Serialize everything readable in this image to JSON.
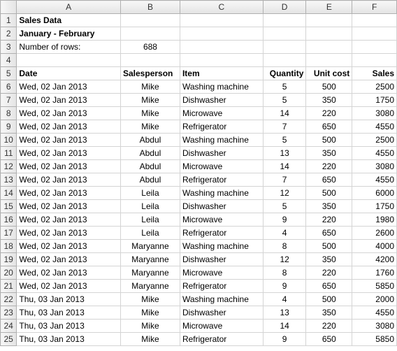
{
  "columns": [
    "A",
    "B",
    "C",
    "D",
    "E",
    "F"
  ],
  "row_numbers": [
    1,
    2,
    3,
    4,
    5,
    6,
    7,
    8,
    9,
    10,
    11,
    12,
    13,
    14,
    15,
    16,
    17,
    18,
    19,
    20,
    21,
    22,
    23,
    24,
    25
  ],
  "header": {
    "title": "Sales Data",
    "subtitle": "January - February",
    "num_rows_label": "Number of rows:",
    "num_rows_value": "688"
  },
  "table_headers": {
    "date": "Date",
    "salesperson": "Salesperson",
    "item": "Item",
    "quantity": "Quantity",
    "unit_cost": "Unit cost",
    "sales": "Sales"
  },
  "rows": [
    {
      "date": "Wed, 02 Jan 2013",
      "sp": "Mike",
      "item": "Washing machine",
      "qty": "5",
      "uc": "500",
      "sales": "2500"
    },
    {
      "date": "Wed, 02 Jan 2013",
      "sp": "Mike",
      "item": "Dishwasher",
      "qty": "5",
      "uc": "350",
      "sales": "1750"
    },
    {
      "date": "Wed, 02 Jan 2013",
      "sp": "Mike",
      "item": "Microwave",
      "qty": "14",
      "uc": "220",
      "sales": "3080"
    },
    {
      "date": "Wed, 02 Jan 2013",
      "sp": "Mike",
      "item": "Refrigerator",
      "qty": "7",
      "uc": "650",
      "sales": "4550"
    },
    {
      "date": "Wed, 02 Jan 2013",
      "sp": "Abdul",
      "item": "Washing machine",
      "qty": "5",
      "uc": "500",
      "sales": "2500"
    },
    {
      "date": "Wed, 02 Jan 2013",
      "sp": "Abdul",
      "item": "Dishwasher",
      "qty": "13",
      "uc": "350",
      "sales": "4550"
    },
    {
      "date": "Wed, 02 Jan 2013",
      "sp": "Abdul",
      "item": "Microwave",
      "qty": "14",
      "uc": "220",
      "sales": "3080"
    },
    {
      "date": "Wed, 02 Jan 2013",
      "sp": "Abdul",
      "item": "Refrigerator",
      "qty": "7",
      "uc": "650",
      "sales": "4550"
    },
    {
      "date": "Wed, 02 Jan 2013",
      "sp": "Leila",
      "item": "Washing machine",
      "qty": "12",
      "uc": "500",
      "sales": "6000"
    },
    {
      "date": "Wed, 02 Jan 2013",
      "sp": "Leila",
      "item": "Dishwasher",
      "qty": "5",
      "uc": "350",
      "sales": "1750"
    },
    {
      "date": "Wed, 02 Jan 2013",
      "sp": "Leila",
      "item": "Microwave",
      "qty": "9",
      "uc": "220",
      "sales": "1980"
    },
    {
      "date": "Wed, 02 Jan 2013",
      "sp": "Leila",
      "item": "Refrigerator",
      "qty": "4",
      "uc": "650",
      "sales": "2600"
    },
    {
      "date": "Wed, 02 Jan 2013",
      "sp": "Maryanne",
      "item": "Washing machine",
      "qty": "8",
      "uc": "500",
      "sales": "4000"
    },
    {
      "date": "Wed, 02 Jan 2013",
      "sp": "Maryanne",
      "item": "Dishwasher",
      "qty": "12",
      "uc": "350",
      "sales": "4200"
    },
    {
      "date": "Wed, 02 Jan 2013",
      "sp": "Maryanne",
      "item": "Microwave",
      "qty": "8",
      "uc": "220",
      "sales": "1760"
    },
    {
      "date": "Wed, 02 Jan 2013",
      "sp": "Maryanne",
      "item": "Refrigerator",
      "qty": "9",
      "uc": "650",
      "sales": "5850"
    },
    {
      "date": "Thu, 03 Jan 2013",
      "sp": "Mike",
      "item": "Washing machine",
      "qty": "4",
      "uc": "500",
      "sales": "2000"
    },
    {
      "date": "Thu, 03 Jan 2013",
      "sp": "Mike",
      "item": "Dishwasher",
      "qty": "13",
      "uc": "350",
      "sales": "4550"
    },
    {
      "date": "Thu, 03 Jan 2013",
      "sp": "Mike",
      "item": "Microwave",
      "qty": "14",
      "uc": "220",
      "sales": "3080"
    },
    {
      "date": "Thu, 03 Jan 2013",
      "sp": "Mike",
      "item": "Refrigerator",
      "qty": "9",
      "uc": "650",
      "sales": "5850"
    }
  ]
}
